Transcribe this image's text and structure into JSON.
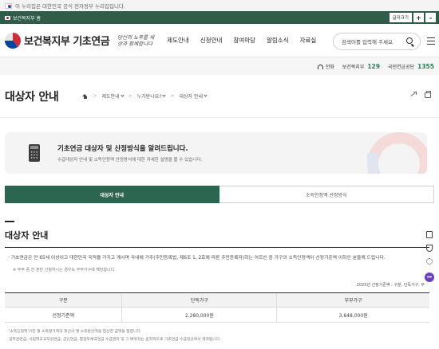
{
  "gov_banner": {
    "text": "이 누리집은 대한민국 공식 전자정부 누리집입니다."
  },
  "topbar": {
    "site_tag": "보건복지부 홈",
    "font_size_label": "글자크기",
    "plus": "+",
    "minus": "-"
  },
  "header": {
    "logo": "보건복지부 기초연금",
    "slogan": "당신의 노후를 세상과 함께합니다",
    "nav": [
      "제도안내",
      "신청안내",
      "참여마당",
      "알림소식",
      "자료실"
    ],
    "search_placeholder": "검색어를 입력해 주세요"
  },
  "info_bar": {
    "chat_label": "전화",
    "hotline1_label": "보건복지부",
    "hotline1_number": "129",
    "hotline2_label": "국민연금공단",
    "hotline2_number": "1355"
  },
  "page": {
    "title": "대상자 안내",
    "breadcrumb": [
      "제도안내",
      "누가받나요?",
      "대상자 안내"
    ]
  },
  "intro": {
    "title": "기초연금 대상자 및 산정방식을 알려드립니다.",
    "subtitle": "수급대상자 안내 및 소득인정액 산정방식에 대한 자세한 설명을 볼 수 있습니다."
  },
  "tabs": [
    {
      "label": "대상자 안내",
      "active": true
    },
    {
      "label": "소득인정액 산정방식",
      "active": false
    }
  ],
  "section": {
    "title": "대상자 안내",
    "bullet": "기초연금은 만 65세 이상이고 대한민국 국적을 가지고 계시며 국내에 거주(주민등록법, 제6조 1, 2호에 따른 주민등록자)하는 어르신 중 가구의 소득인정액이 선정기준액 이하인 분들께 드립니다.",
    "note": "부부 중 한 분만 신청하시는 경우도 부부가구에 해당합니다.",
    "unit_note": "2025년 선정기준액 : 구분, 단독가구, 부"
  },
  "table": {
    "headers": [
      "구분",
      "단독가구",
      "부부가구"
    ],
    "rows": [
      [
        "선정기준액",
        "2,280,000원",
        "3,648,000원"
      ]
    ]
  },
  "footnotes": [
    "'소득인정액'이란 월 소득평가액과 재산의 월 소득환산액을 합산한 금액을 말합니다.",
    "공무원연금, 사립학교교직원연금, 군인연금, 별정우체국연금 수급권자 및 그 배우자는 원칙적으로 기초연금 수급대상에서 제외됩니다."
  ]
}
